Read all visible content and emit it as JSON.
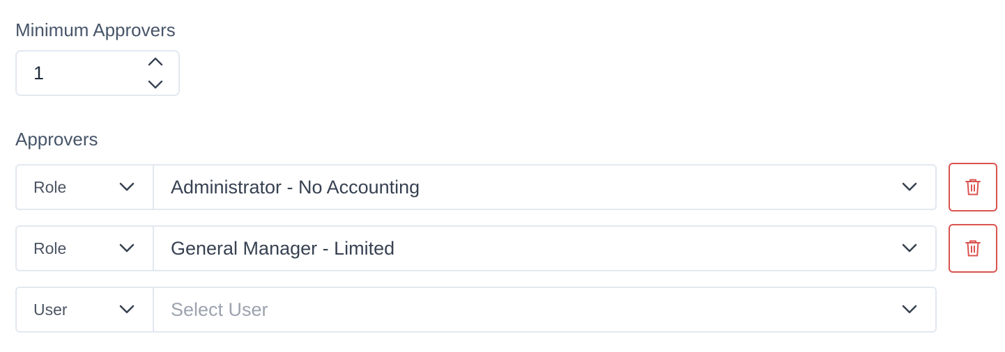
{
  "minimum_approvers": {
    "label": "Minimum Approvers",
    "value": "1"
  },
  "approvers": {
    "label": "Approvers",
    "rows": [
      {
        "type": "Role",
        "value": "Administrator - No Accounting",
        "is_placeholder": false,
        "has_delete": true
      },
      {
        "type": "Role",
        "value": "General Manager - Limited",
        "is_placeholder": false,
        "has_delete": true
      },
      {
        "type": "User",
        "value": "Select User",
        "is_placeholder": true,
        "has_delete": false
      }
    ]
  },
  "icons": {
    "chevron": "chevron-down-icon",
    "stepper_up": "chevron-up-icon",
    "stepper_down": "chevron-down-icon",
    "delete": "trash-icon"
  },
  "colors": {
    "border": "#e2e8f0",
    "danger": "#d9534f",
    "text": "#374151",
    "placeholder": "#9ca3af"
  }
}
